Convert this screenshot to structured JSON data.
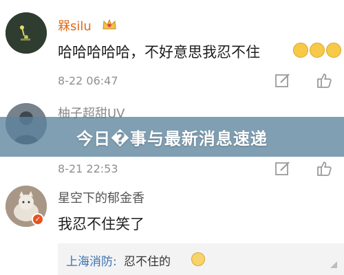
{
  "comments": [
    {
      "username": "槑silu",
      "text": "哈哈哈哈哈，不好意思我忍不住",
      "emoji_count": 3,
      "timestamp": "8-22 06:47"
    },
    {
      "username": "柚子超甜UV",
      "timestamp": "8-21 22:53"
    },
    {
      "username": "星空下的郁金香",
      "text": "我忍不住笑了",
      "reply": {
        "user": "上海消防:",
        "text": "忍不住的"
      }
    }
  ],
  "banner": {
    "title": "今日�事与最新消息速递"
  },
  "icons": {
    "crown": "crown-badge-icon",
    "verified": "verified-badge-icon",
    "laugh": "laughing-emoji-icon",
    "edit": "comment-edit-icon",
    "like": "thumbs-up-icon"
  },
  "colors": {
    "username_accent": "#e06a18",
    "banner_bg": "#5c849e",
    "reply_user": "#3b6fae"
  }
}
